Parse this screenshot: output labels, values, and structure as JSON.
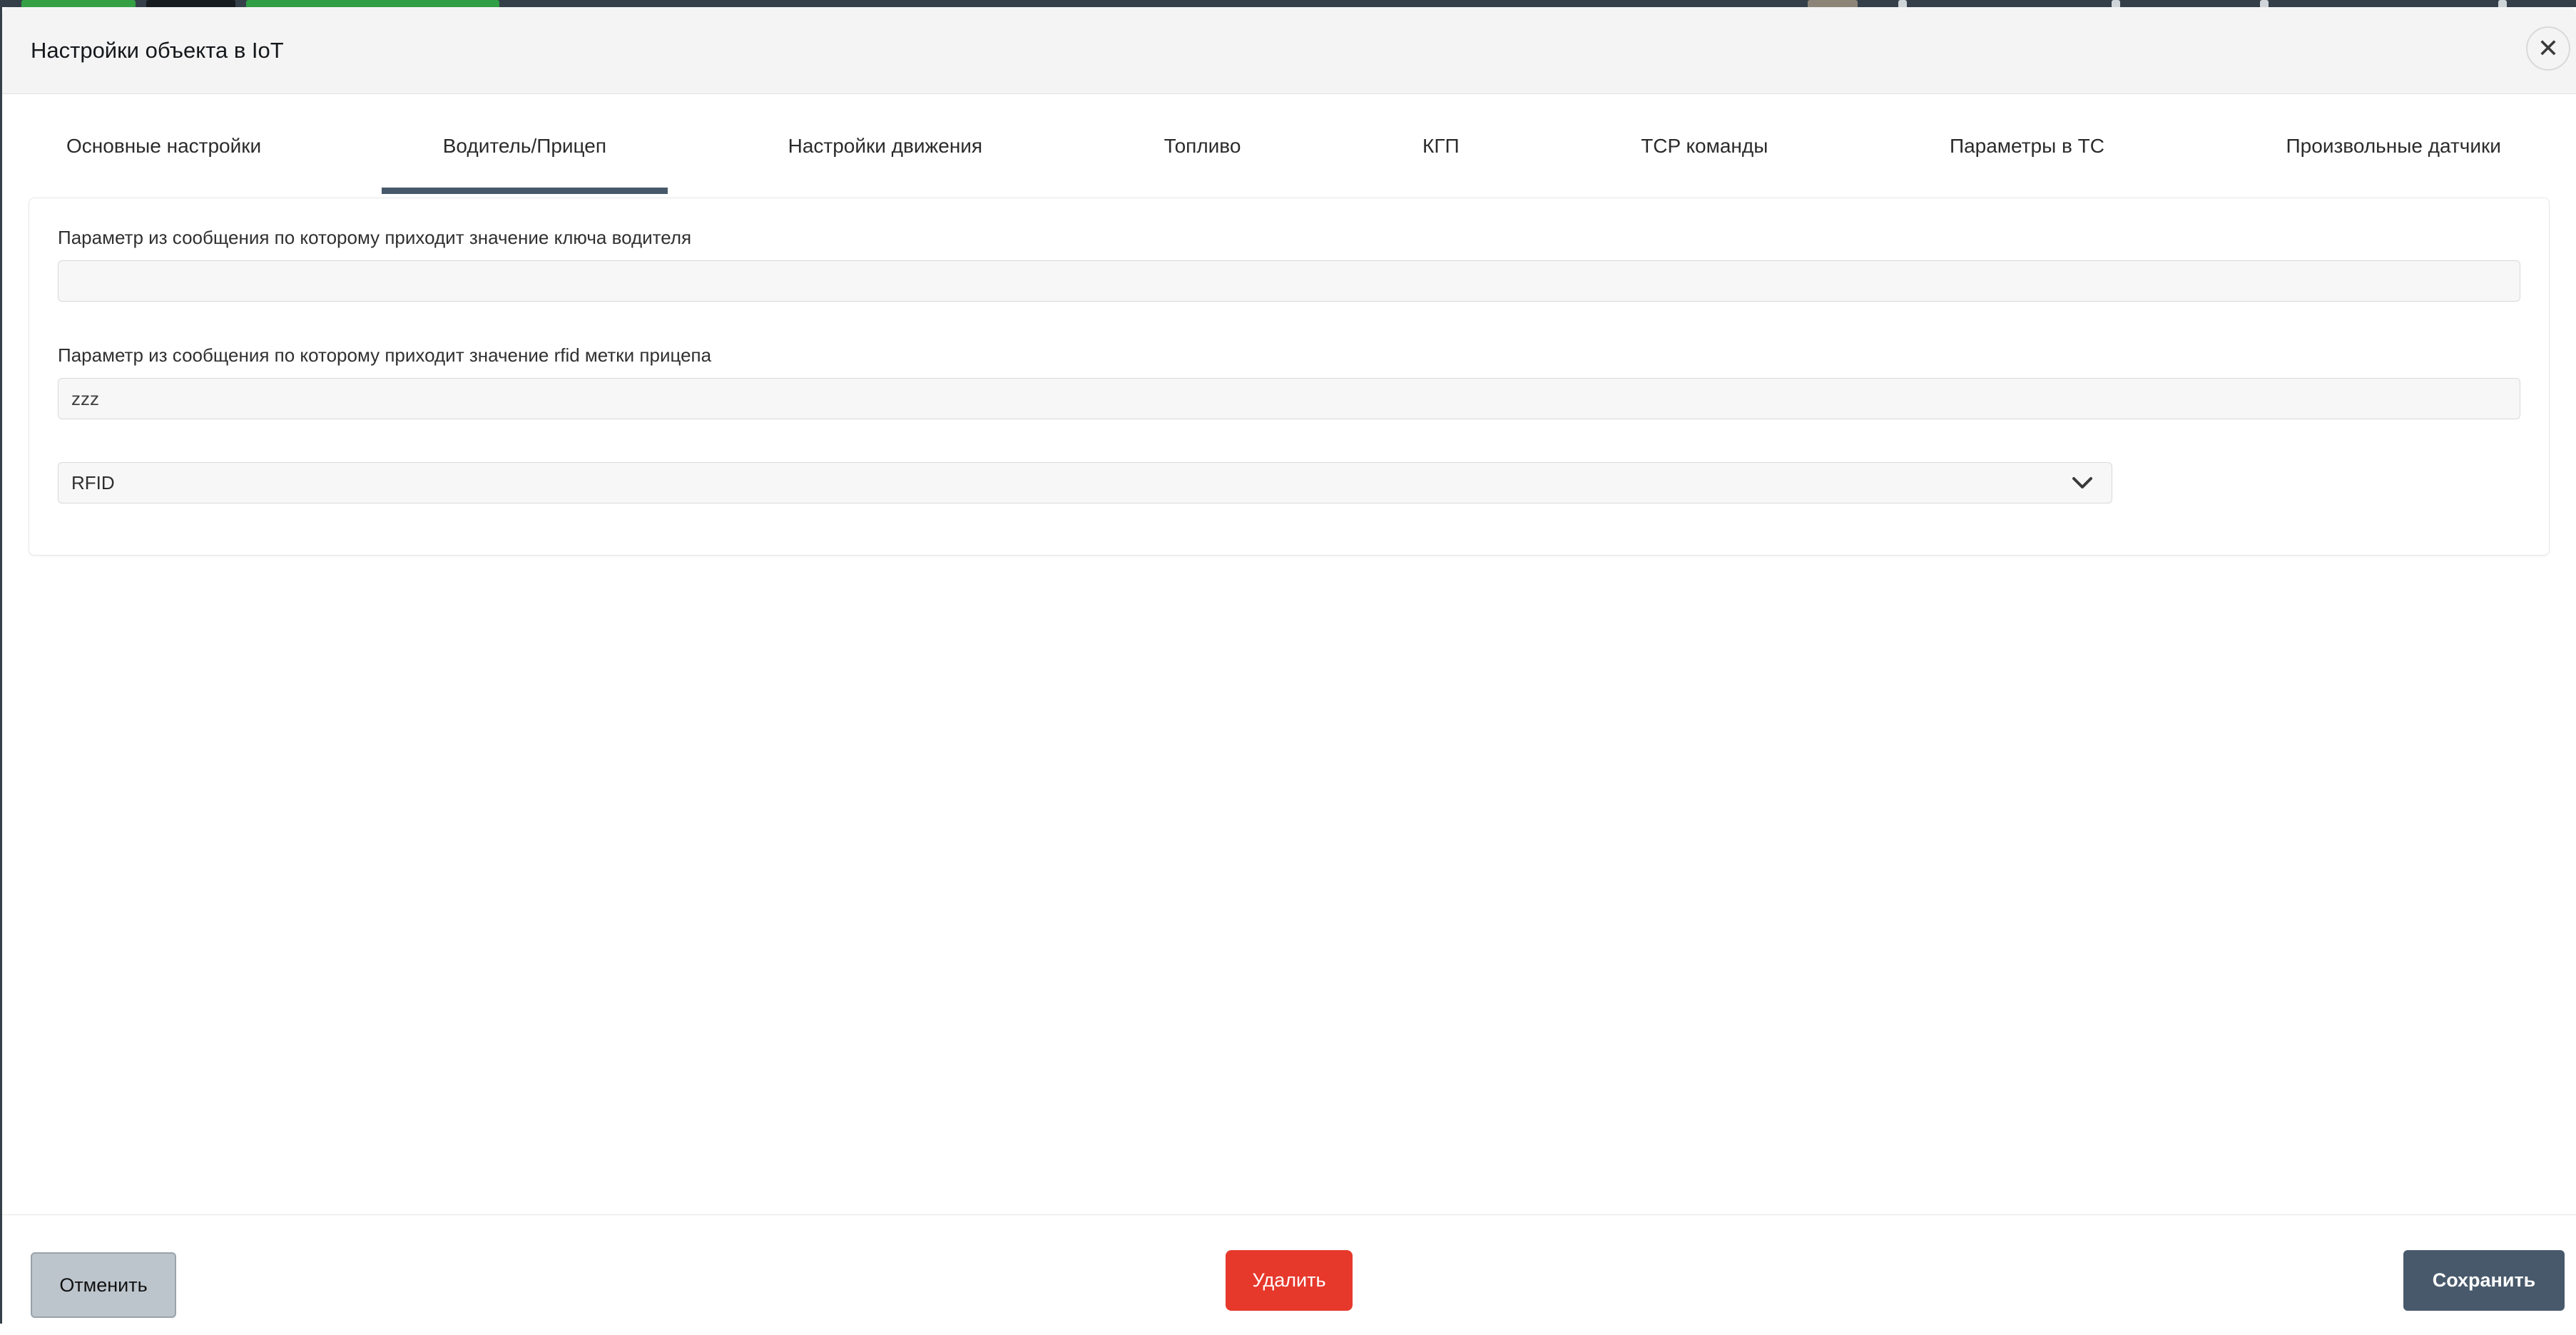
{
  "modal": {
    "title": "Настройки объекта в IoT",
    "close_icon": "✕",
    "tabs": [
      {
        "label": "Основные настройки"
      },
      {
        "label": "Водитель/Прицеп"
      },
      {
        "label": "Настройки движения"
      },
      {
        "label": "Топливо"
      },
      {
        "label": "КГП"
      },
      {
        "label": "TCP команды"
      },
      {
        "label": "Параметры в ТС"
      },
      {
        "label": "Произвольные датчики"
      }
    ],
    "active_tab": "Водитель/Прицеп",
    "form": {
      "driver_key_label": "Параметр из сообщения по которому приходит значение ключа водителя",
      "driver_key_value": "",
      "trailer_rfid_label": "Параметр из сообщения по которому приходит значение rfid метки прицепа",
      "trailer_rfid_value": "zzz",
      "rfid_type_value": "RFID"
    },
    "footer": {
      "cancel_label": "Отменить",
      "delete_label": "Удалить",
      "save_label": "Сохранить"
    },
    "colors": {
      "active_tab_underline": "#47596b",
      "save_button": "#48596b",
      "delete_button": "#e6392c",
      "cancel_button": "#bdc5cc",
      "header_background": "#f4f4f5",
      "input_background": "#f7f7f8",
      "page_top_strip": "#343f49"
    }
  }
}
